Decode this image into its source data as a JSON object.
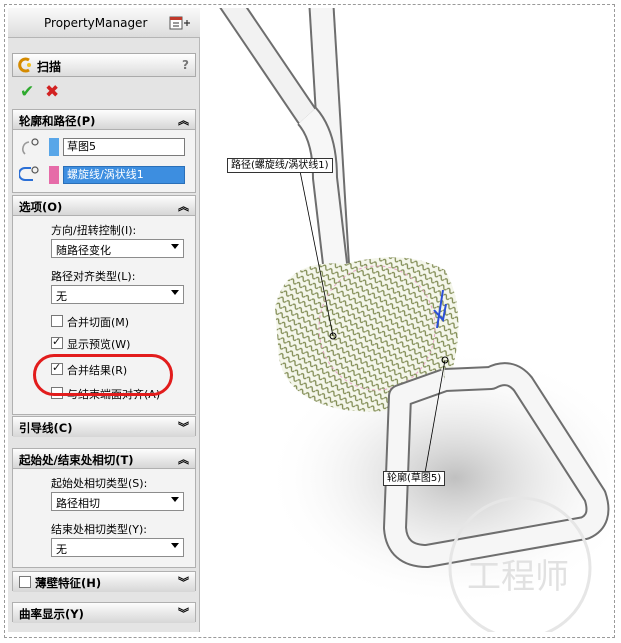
{
  "property_manager": {
    "title": "PropertyManager"
  },
  "feature": {
    "name": "扫描",
    "help": "?"
  },
  "profile_path": {
    "title": "轮廓和路径(P)",
    "profile_value": "草图5",
    "path_value": "螺旋线/涡状线1"
  },
  "options": {
    "title": "选项(O)",
    "orientation_label": "方向/扭转控制(I):",
    "orientation_value": "随路径变化",
    "path_align_label": "路径对齐类型(L):",
    "path_align_value": "无",
    "merge_tangent_label": "合并切面(M)",
    "show_preview_label": "显示预览(W)",
    "merge_result_label": "合并结果(R)",
    "align_end_label": "与结束端面对齐(A)"
  },
  "guide_curves": {
    "title": "引导线(C)"
  },
  "start_end": {
    "title": "起始处/结束处相切(T)",
    "start_label": "起始处相切类型(S):",
    "start_value": "路径相切",
    "end_label": "结束处相切类型(Y):",
    "end_value": "无"
  },
  "thin_feature": {
    "title": "薄壁特征(H)"
  },
  "curvature": {
    "title": "曲率显示(Y)"
  },
  "viewport": {
    "path_callout": "路径(螺旋线/涡状线1)",
    "profile_callout": "轮廓(草图5)",
    "watermark": "工程师"
  },
  "colors": {
    "accent": "#3d8ee0",
    "highlight": "#e21c1c",
    "profile_swatch": "#59a6e8",
    "path_swatch": "#e66ba8"
  }
}
